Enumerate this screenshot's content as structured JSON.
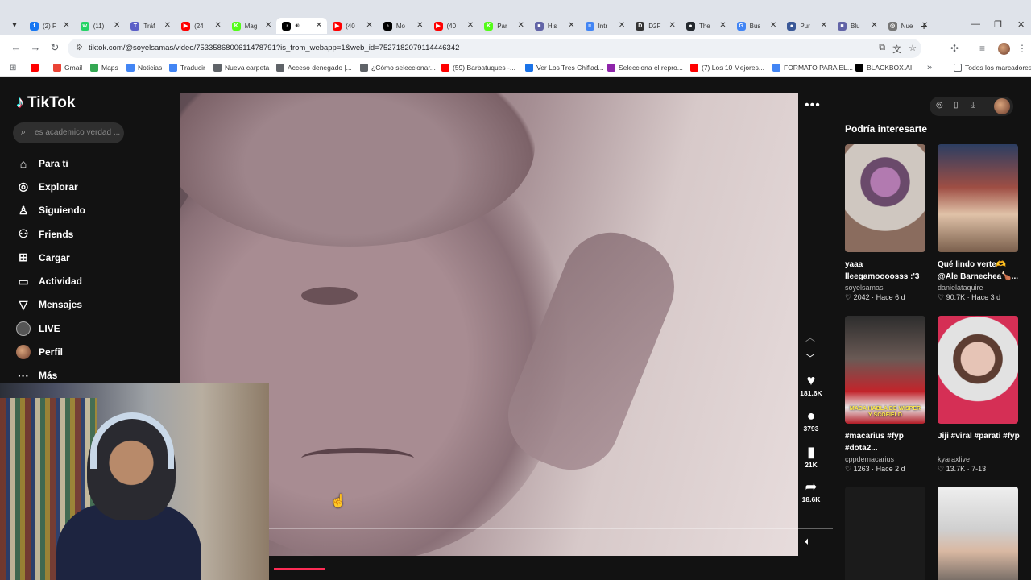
{
  "tabs": [
    {
      "label": "(2) F",
      "icon": "facebook-icon",
      "color": "#1877f2",
      "glyph": "f"
    },
    {
      "label": "(11)",
      "icon": "whatsapp-icon",
      "color": "#25d366",
      "glyph": "w"
    },
    {
      "label": "Tráf",
      "icon": "teams-icon",
      "color": "#5b5fc7",
      "glyph": "T"
    },
    {
      "label": "(24",
      "icon": "youtube-icon",
      "color": "#ff0000",
      "glyph": "▶"
    },
    {
      "label": "Mag",
      "icon": "kick-icon",
      "color": "#53fc18",
      "glyph": "K"
    },
    {
      "label": "",
      "icon": "tiktok-icon",
      "color": "#000000",
      "glyph": "♪",
      "active": true
    },
    {
      "label": "(40",
      "icon": "youtube-icon",
      "color": "#ff0000",
      "glyph": "▶"
    },
    {
      "label": "Mo",
      "icon": "tiktok-icon",
      "color": "#000000",
      "glyph": "♪"
    },
    {
      "label": "(40",
      "icon": "youtube-icon",
      "color": "#ff0000",
      "glyph": "▶"
    },
    {
      "label": "Par",
      "icon": "kick-icon",
      "color": "#53fc18",
      "glyph": "K"
    },
    {
      "label": "His",
      "icon": "video-icon",
      "color": "#6264a7",
      "glyph": "■"
    },
    {
      "label": "Intr",
      "icon": "docs-icon",
      "color": "#4285f4",
      "glyph": "≡"
    },
    {
      "label": "D2F",
      "icon": "d2-icon",
      "color": "#333333",
      "glyph": "D"
    },
    {
      "label": "The",
      "icon": "github-icon",
      "color": "#24292f",
      "glyph": "●"
    },
    {
      "label": "Bus",
      "icon": "google-icon",
      "color": "#4285f4",
      "glyph": "G"
    },
    {
      "label": "Pur",
      "icon": "globe-icon",
      "color": "#3b5998",
      "glyph": "●"
    },
    {
      "label": "Blu",
      "icon": "video-icon",
      "color": "#6264a7",
      "glyph": "■"
    },
    {
      "label": "Nue",
      "icon": "chrome-icon",
      "color": "#777777",
      "glyph": "◎"
    }
  ],
  "url": "tiktok.com/@soyelsamas/video/7533586800611478791?is_from_webapp=1&web_id=7527182079114446342",
  "bookmarks": [
    {
      "label": "",
      "color": "#ff0000"
    },
    {
      "label": "Gmail",
      "color": "#ea4335"
    },
    {
      "label": "Maps",
      "color": "#34a853"
    },
    {
      "label": "Noticias",
      "color": "#4285f4"
    },
    {
      "label": "Traducir",
      "color": "#4285f4"
    },
    {
      "label": "Nueva carpeta",
      "color": "#5f6368"
    },
    {
      "label": "Acceso denegado |...",
      "color": "#5f6368"
    },
    {
      "label": "¿Cómo seleccionar...",
      "color": "#5f6368"
    },
    {
      "label": "(59) Barbatuques -...",
      "color": "#ff0000"
    },
    {
      "label": "Ver Los Tres Chiflad...",
      "color": "#1a73e8"
    },
    {
      "label": "Selecciona el repro...",
      "color": "#8e24aa"
    },
    {
      "label": "(7) Los 10 Mejores...",
      "color": "#ff0000"
    },
    {
      "label": "FORMATO PARA EL...",
      "color": "#4285f4"
    },
    {
      "label": "BLACKBOX.AI",
      "color": "#000000"
    }
  ],
  "bookmarks_folder": "Todos los marcadores",
  "tiktok": {
    "logo": "TikTok",
    "search_placeholder": "es academico verdad ...",
    "nav": [
      {
        "label": "Para ti",
        "icon": "home-icon",
        "glyph": "⌂"
      },
      {
        "label": "Explorar",
        "icon": "compass-icon",
        "glyph": "◎"
      },
      {
        "label": "Siguiendo",
        "icon": "following-icon",
        "glyph": "♙"
      },
      {
        "label": "Friends",
        "icon": "friends-icon",
        "glyph": "⚇"
      },
      {
        "label": "Cargar",
        "icon": "upload-icon",
        "glyph": "⊞"
      },
      {
        "label": "Actividad",
        "icon": "activity-icon",
        "glyph": "▭"
      },
      {
        "label": "Mensajes",
        "icon": "messages-icon",
        "glyph": "▽"
      },
      {
        "label": "LIVE",
        "icon": "live-icon",
        "glyph": ""
      },
      {
        "label": "Perfil",
        "icon": "profile-avatar",
        "glyph": ""
      },
      {
        "label": "Más",
        "icon": "more-icon",
        "glyph": "···"
      }
    ],
    "actions": [
      {
        "icon": "heart-icon",
        "glyph": "♥",
        "count": "181.6K"
      },
      {
        "icon": "comment-icon",
        "glyph": "●",
        "count": "3793"
      },
      {
        "icon": "bookmark-icon",
        "glyph": "▮",
        "count": "21K"
      },
      {
        "icon": "share-icon",
        "glyph": "➦",
        "count": "18.6K"
      }
    ],
    "progress": 0.09,
    "recommend_title": "Podría interesarte",
    "recommendations": [
      {
        "caption": "yaaa lleegamoooosss :'3",
        "author": "soyelsamas",
        "likes": "2042",
        "date": "Hace 6 d",
        "thumb": "t1",
        "overlay": ""
      },
      {
        "caption": "Qué lindo verte🫶 @Ale Barnechea🍗...",
        "author": "danielataquire",
        "likes": "90.7K",
        "date": "Hace 3 d",
        "thumb": "t2",
        "overlay": ""
      },
      {
        "caption": "#macarius #fyp #dota2...",
        "author": "cppdemacarius",
        "likes": "1263",
        "date": "Hace 2 d",
        "thumb": "t3",
        "overlay": "MACA HABLA DE WISPER Y SCOFIELD"
      },
      {
        "caption": "Jiji #viral #parati #fyp",
        "author": "kyaraxlive",
        "likes": "13.7K",
        "date": "7-13",
        "thumb": "t4",
        "overlay": ""
      },
      {
        "caption": "",
        "author": "",
        "likes": "",
        "date": "",
        "thumb": "t5",
        "overlay": ""
      },
      {
        "caption": "",
        "author": "",
        "likes": "",
        "date": "",
        "thumb": "t6",
        "overlay": ""
      }
    ]
  }
}
